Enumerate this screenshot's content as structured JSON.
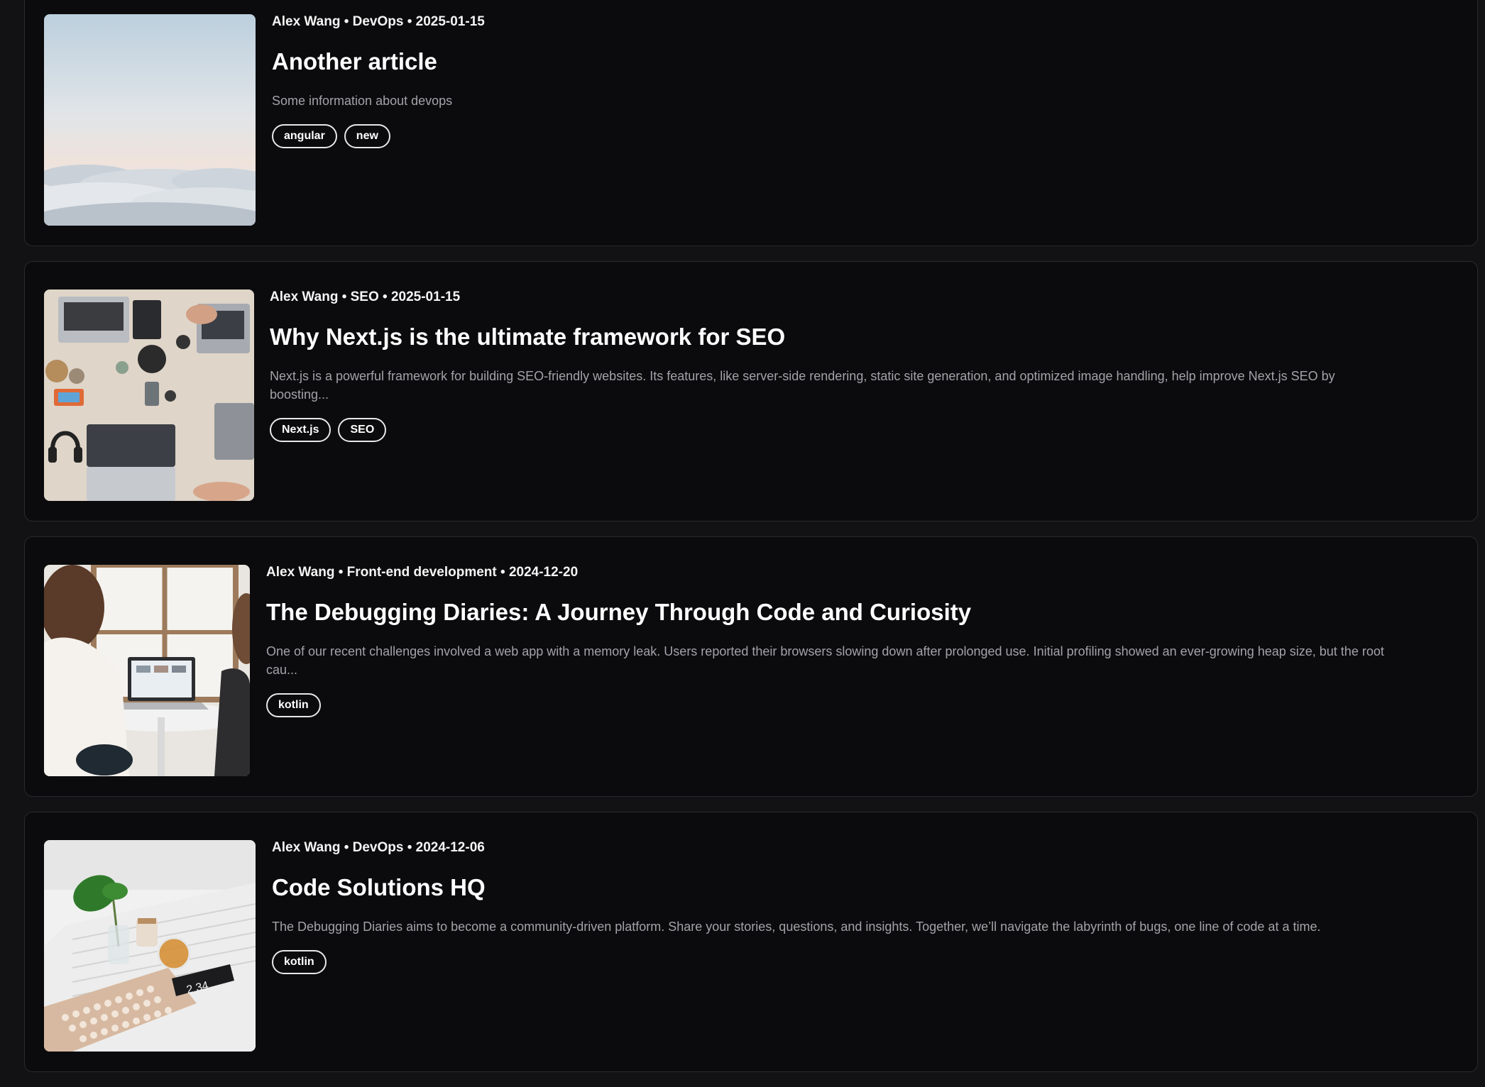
{
  "articles": [
    {
      "meta": "Alex Wang • DevOps • 2025-01-15",
      "title": "Another article",
      "excerpt": "Some information about devops",
      "tags": [
        "angular",
        "new"
      ],
      "thumbnail_icon": "clouds-sky-image"
    },
    {
      "meta": "Alex Wang • SEO • 2025-01-15",
      "title": "Why Next.js is the ultimate framework for SEO",
      "excerpt": "Next.js is a powerful framework for building SEO-friendly websites. Its features, like server-side rendering, static site generation, and optimized image handling, help improve Next.js SEO by boosting...",
      "tags": [
        "Next.js",
        "SEO"
      ],
      "thumbnail_icon": "laptops-desk-image"
    },
    {
      "meta": "Alex Wang • Front-end development • 2024-12-20",
      "title": "The Debugging Diaries: A Journey Through Code and Curiosity",
      "excerpt": "One of our recent challenges involved a web app with a memory leak. Users reported their browsers slowing down after prolonged use. Initial profiling showed an ever-growing heap size, but the root cau...",
      "tags": [
        "kotlin"
      ],
      "thumbnail_icon": "people-laptop-image"
    },
    {
      "meta": "Alex Wang • DevOps • 2024-12-06",
      "title": "Code Solutions HQ",
      "excerpt": "The Debugging Diaries aims to become a community-driven platform. Share your stories, questions, and insights. Together, we’ll navigate the labyrinth of bugs, one line of code at a time.",
      "tags": [
        "kotlin"
      ],
      "thumbnail_icon": "keyboard-plant-image"
    }
  ]
}
